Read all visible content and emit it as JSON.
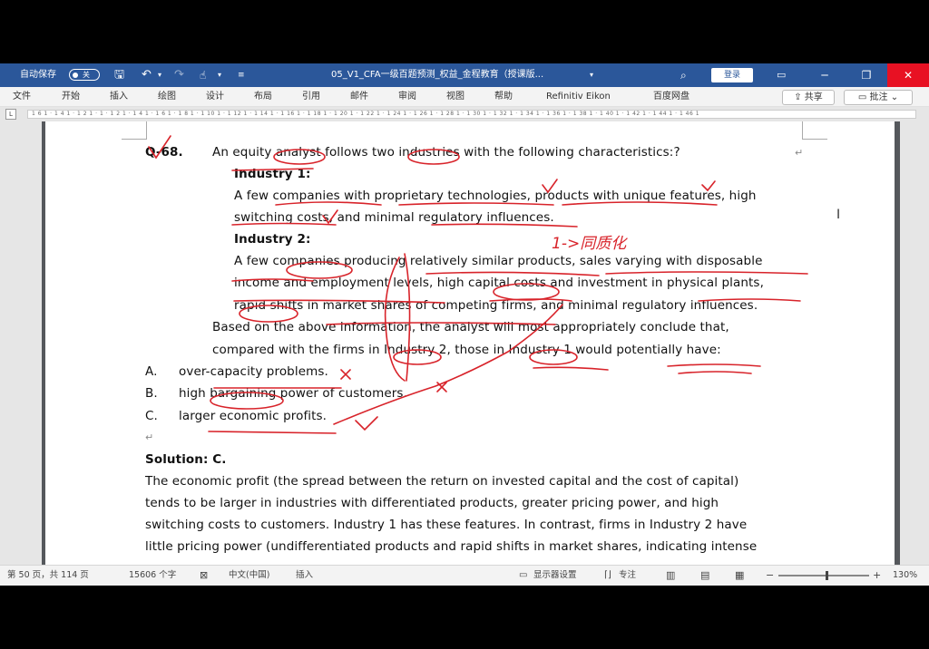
{
  "titlebar": {
    "autosave_label": "自动保存",
    "autosave_state": "关",
    "doc_title": "05_V1_CFA一级百题预测_权益_金程教育（授课版...",
    "login_label": "登录",
    "minimize": "─",
    "restore": "❐",
    "close": "✕"
  },
  "ribbon": {
    "tabs": [
      "文件",
      "开始",
      "插入",
      "绘图",
      "设计",
      "布局",
      "引用",
      "邮件",
      "审阅",
      "视图",
      "帮助",
      "Refinitiv Eikon",
      "百度网盘"
    ],
    "share_label": "共享",
    "comment_label": "批注"
  },
  "ruler": {
    "corner": "L",
    "ticks": "1 6 1 · 1 4 1 · 1 2 1 · 1 · 1 2 1 · 1 4 1 · 1 6 1 · 1 8 1 · 1 10 1 · 1 12 1 · 1 14 1 · 1 16 1 · 1 18 1 · 1 20 1 · 1 22 1 · 1 24 1 · 1 26 1 · 1 28 1 · 1 30 1 · 1 32 1 · 1 34 1 · 1 36 1 · 1 38 1 · 1 40 1 · 1 42 1 · 1 44 1 · 1 46 1"
  },
  "document": {
    "question_number": "Q-68.",
    "question_intro": "An equity analyst follows two industries with the following characteristics:?",
    "industry1_heading": "Industry 1:",
    "industry1_line1": "A few companies with proprietary technologies, products with unique features, high",
    "industry1_line2": "switching costs, and minimal regulatory influences.",
    "industry2_heading": "Industry 2:",
    "industry2_line1": "A few companies producing relatively similar products, sales varying with disposable",
    "industry2_line2": "income and employment levels, high capital costs and investment in physical plants,",
    "industry2_line3": "rapid shifts in market shares of competing firms, and minimal regulatory influences.",
    "prompt_line1": "Based on the above information, the analyst will most appropriately conclude that,",
    "prompt_line2": "compared with the firms in Industry 2, those in Industry 1 would potentially have:",
    "options": [
      {
        "letter": "A.",
        "text": "over-capacity problems."
      },
      {
        "letter": "B.",
        "text": "high bargaining power of customers."
      },
      {
        "letter": "C.",
        "text": "larger economic profits."
      }
    ],
    "solution_label": "Solution: C.",
    "solution_line1": "The economic profit (the spread between the return on invested capital and the cost of capital)",
    "solution_line2": "tends to be larger in industries with differentiated products, greater pricing power, and high",
    "solution_line3": "switching costs to customers. Industry 1 has these features. In contrast, firms in Industry 2 have",
    "solution_line4": "little pricing power (undifferentiated products and rapid shifts in market shares, indicating intense",
    "handwritten_note": "1->同质化"
  },
  "statusbar": {
    "page_info": "第 50 页，共 114 页",
    "word_count": "15606 个字",
    "language": "中文(中国)",
    "insert_mode": "插入",
    "display_settings": "显示器设置",
    "focus": "专注",
    "zoom_level": "130%",
    "zoom_fraction": 0.52
  }
}
